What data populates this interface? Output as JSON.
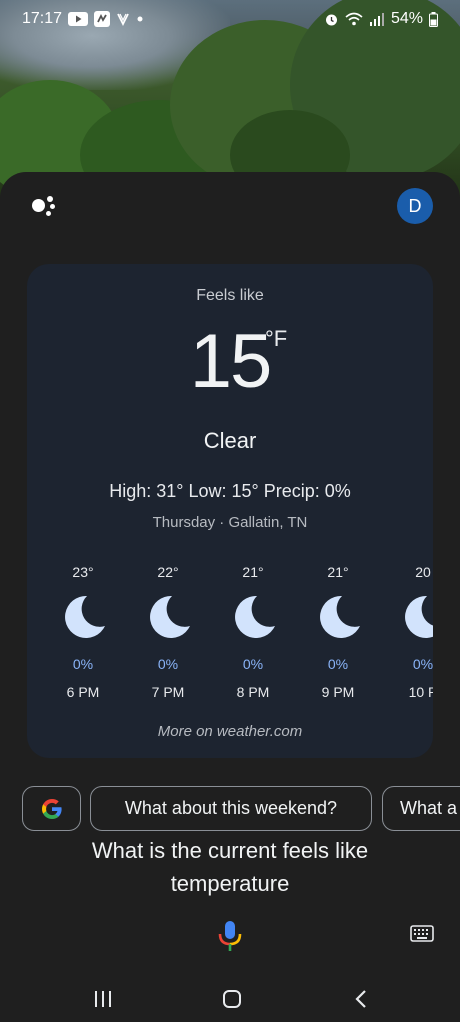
{
  "status_bar": {
    "time": "17:17",
    "battery": "54%",
    "icons": [
      "youtube-icon",
      "generic-app-icon",
      "vpn-icon",
      "dot-icon",
      "alarm-icon",
      "wifi-icon",
      "signal-icon",
      "battery-icon"
    ]
  },
  "assistant": {
    "avatar_letter": "D"
  },
  "weather": {
    "feels_label": "Feels like",
    "temperature": "15",
    "unit": "°F",
    "condition": "Clear",
    "summary": "High: 31° Low: 15° Precip: 0%",
    "location": "Thursday · Gallatin, TN",
    "hourly": [
      {
        "temp": "23°",
        "precip": "0%",
        "time": "6 PM",
        "icon": "moon-icon"
      },
      {
        "temp": "22°",
        "precip": "0%",
        "time": "7 PM",
        "icon": "moon-icon"
      },
      {
        "temp": "21°",
        "precip": "0%",
        "time": "8 PM",
        "icon": "moon-icon"
      },
      {
        "temp": "21°",
        "precip": "0%",
        "time": "9 PM",
        "icon": "moon-icon"
      },
      {
        "temp": "20",
        "precip": "0%",
        "time": "10 P",
        "icon": "moon-icon"
      }
    ],
    "more_link": "More on weather.com"
  },
  "suggestions": {
    "google_icon": "google-icon",
    "chips": [
      "What about this weekend?",
      "What a"
    ]
  },
  "query_text": "What is the current feels like temperature",
  "colors": {
    "sheet_bg": "#1f1f1f",
    "card_bg": "#1d2430",
    "precip_blue": "#8ab4f8",
    "avatar_blue": "#1a5dab",
    "moon": "#d2e3fc"
  }
}
